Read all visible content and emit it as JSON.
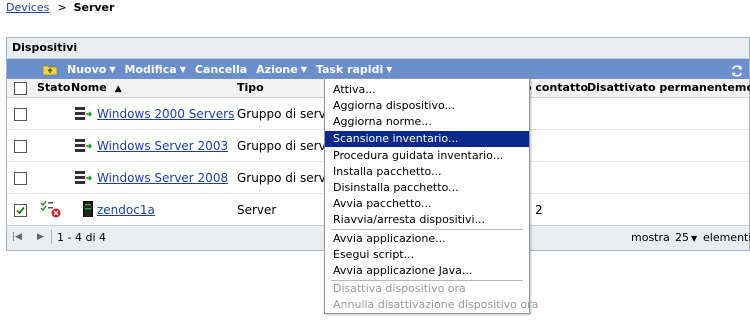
{
  "breadcrumb": {
    "parent": "Devices",
    "separator": ">",
    "current": "Server"
  },
  "panel": {
    "title": "Dispositivi"
  },
  "toolbar": {
    "nuovo": "Nuovo",
    "modifica": "Modifica",
    "cancella": "Cancella",
    "azione": "Azione",
    "task_rapidi": "Task rapidi"
  },
  "table": {
    "headers": {
      "stato": "Stato",
      "nome": "Nome",
      "tipo": "Tipo",
      "contatto": "o contatto",
      "disattivato": "Disattivato permanentemente"
    },
    "rows": [
      {
        "name": "Windows 2000 Servers",
        "type": "Gruppo di serv",
        "checked": false,
        "extra": ""
      },
      {
        "name": "Windows Server 2003",
        "type": "Gruppo di serv",
        "checked": false,
        "extra": ""
      },
      {
        "name": "Windows Server 2008",
        "type": "Gruppo di serv",
        "checked": false,
        "extra": ""
      },
      {
        "name": "zendoc1a",
        "type": "Server",
        "checked": true,
        "extra": "2"
      }
    ]
  },
  "pager": {
    "range": "1 - 4 di 4",
    "show_label": "mostra",
    "page_size": "25",
    "items_label": "elementi"
  },
  "menu": {
    "items": [
      "Attiva...",
      "Aggiorna dispositivo...",
      "Aggiorna norme...",
      "Scansione inventario...",
      "Procedura guidata inventario...",
      "Installa pacchetto...",
      "Disinstalla pacchetto...",
      "Avvia pacchetto...",
      "Riavvia/arresta dispositivi...",
      "Avvia applicazione...",
      "Esegui script...",
      "Avvia applicazione Java...",
      "Disattiva dispositivo ora",
      "Annulla disattivazione dispositivo ora"
    ],
    "selected_index": 3
  },
  "colors": {
    "toolbar": "#6b8fcb",
    "selection": "#0a2a8a",
    "link": "#2040a0"
  }
}
